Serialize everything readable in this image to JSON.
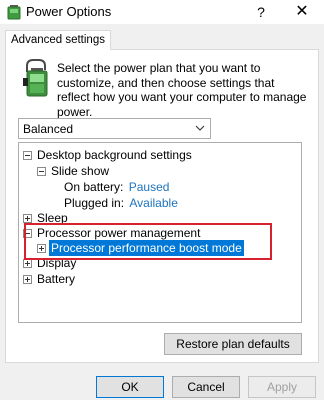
{
  "window": {
    "title": "Power Options",
    "help_label": "?",
    "close_label": "✕"
  },
  "tab": {
    "label": "Advanced settings"
  },
  "description": "Select the power plan that you want to customize, and then choose settings that reflect how you want your computer to manage power.",
  "plan": {
    "selected": "Balanced"
  },
  "tree": {
    "desktop_bg": "Desktop background settings",
    "slide_show": "Slide show",
    "on_battery_label": "On battery:",
    "on_battery_value": "Paused",
    "plugged_in_label": "Plugged in:",
    "plugged_in_value": "Available",
    "sleep": "Sleep",
    "processor_mgmt": "Processor power management",
    "boost_mode": "Processor performance boost mode",
    "display": "Display",
    "battery": "Battery"
  },
  "buttons": {
    "restore": "Restore plan defaults",
    "ok": "OK",
    "cancel": "Cancel",
    "apply": "Apply"
  },
  "colors": {
    "accent": "#0078d7",
    "link_value": "#1e73be",
    "highlight_box": "#d8212f"
  }
}
